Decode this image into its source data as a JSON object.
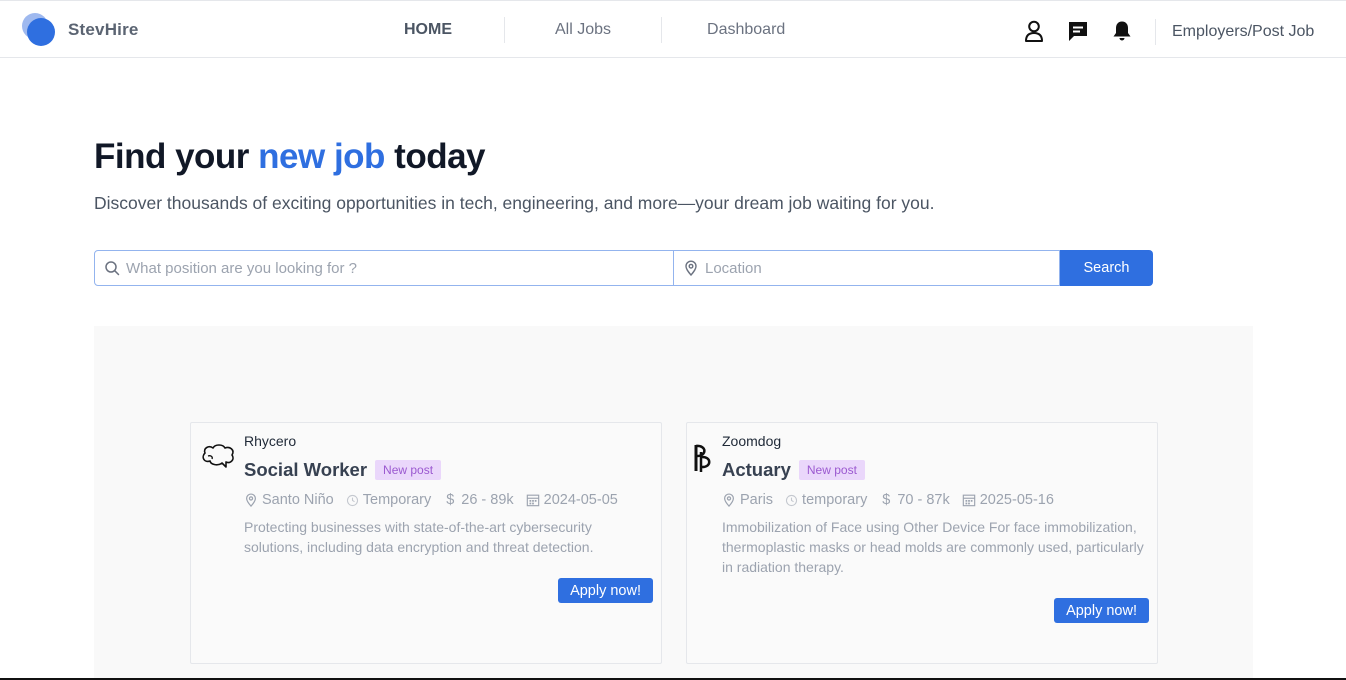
{
  "brand": {
    "name": "StevHire"
  },
  "nav": {
    "items": [
      {
        "label": "HOME",
        "active": true
      },
      {
        "label": "All Jobs",
        "active": false
      },
      {
        "label": "Dashboard",
        "active": false
      }
    ]
  },
  "header": {
    "icons": [
      "user-icon",
      "chat-icon",
      "bell-icon"
    ],
    "employers_link": "Employers/Post Job"
  },
  "hero": {
    "title_pre": "Find your ",
    "title_accent": "new job",
    "title_post": " today",
    "subtitle": "Discover thousands of exciting opportunities in tech, engineering, and more—your dream job waiting for you."
  },
  "search": {
    "position_placeholder": "What position are you looking for ?",
    "location_placeholder": "Location",
    "button_label": "Search"
  },
  "jobs": [
    {
      "company": "Rhycero",
      "title": "Social Worker",
      "badge": "New post",
      "location": "Santo Niño",
      "type": "Temporary",
      "salary": "26 - 89k",
      "date": "2024-05-05",
      "description": "Protecting businesses with state-of-the-art cybersecurity solutions, including data encryption and threat detection.",
      "apply_label": "Apply now!"
    },
    {
      "company": "Zoomdog",
      "title": "Actuary",
      "badge": "New post",
      "location": "Paris",
      "type": "temporary",
      "salary": "70 - 87k",
      "date": "2025-05-16",
      "description": "Immobilization of Face using Other Device For face immobilization, thermoplastic masks or head molds are commonly used, particularly in radiation therapy.",
      "apply_label": "Apply now!"
    }
  ],
  "colors": {
    "accent": "#2f6fe0",
    "badge_bg": "#ead7fb",
    "badge_text": "#9b59d0"
  }
}
